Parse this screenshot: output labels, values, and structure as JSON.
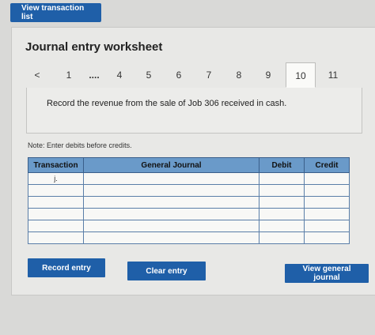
{
  "top_button": "View transaction list",
  "worksheet": {
    "title": "Journal entry worksheet",
    "nav": {
      "prev": "<",
      "tabs": [
        {
          "label": "1"
        },
        {
          "label": "...."
        },
        {
          "label": "4"
        },
        {
          "label": "5"
        },
        {
          "label": "6"
        },
        {
          "label": "7"
        },
        {
          "label": "8"
        },
        {
          "label": "9"
        },
        {
          "label": "10"
        },
        {
          "label": "11"
        }
      ],
      "active_tab": "10"
    },
    "prompt": "Record the revenue from the sale of Job 306 received in cash.",
    "note": "Note: Enter debits before credits.",
    "table": {
      "headers": [
        "Transaction",
        "General Journal",
        "Debit",
        "Credit"
      ],
      "rows": [
        {
          "transaction": "j.",
          "account": "",
          "debit": "",
          "credit": ""
        },
        {
          "transaction": "",
          "account": "",
          "debit": "",
          "credit": ""
        },
        {
          "transaction": "",
          "account": "",
          "debit": "",
          "credit": ""
        },
        {
          "transaction": "",
          "account": "",
          "debit": "",
          "credit": ""
        },
        {
          "transaction": "",
          "account": "",
          "debit": "",
          "credit": ""
        },
        {
          "transaction": "",
          "account": "",
          "debit": "",
          "credit": ""
        }
      ]
    },
    "buttons": {
      "record": "Record entry",
      "clear": "Clear entry",
      "view_journal": "View general journal"
    }
  },
  "colors": {
    "button": "#1f5fa8",
    "table_header": "#6a9ac9",
    "page_bg": "#d9d9d7"
  }
}
